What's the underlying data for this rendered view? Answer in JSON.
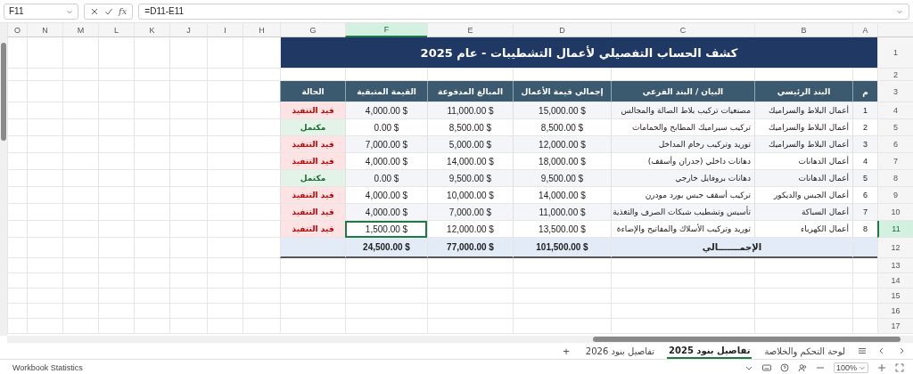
{
  "formula_bar": {
    "name_box": "F11",
    "function_label": "fx",
    "formula": "=D11-E11"
  },
  "column_headers": [
    {
      "label": "A",
      "selected": false
    },
    {
      "label": "B",
      "selected": false
    },
    {
      "label": "C",
      "selected": false
    },
    {
      "label": "D",
      "selected": false
    },
    {
      "label": "E",
      "selected": false
    },
    {
      "label": "F",
      "selected": true
    },
    {
      "label": "G",
      "selected": false
    },
    {
      "label": "H",
      "selected": false
    },
    {
      "label": "I",
      "selected": false
    },
    {
      "label": "J",
      "selected": false
    },
    {
      "label": "K",
      "selected": false
    },
    {
      "label": "L",
      "selected": false
    },
    {
      "label": "M",
      "selected": false
    },
    {
      "label": "N",
      "selected": false
    },
    {
      "label": "O",
      "selected": false
    }
  ],
  "title": "كشف الحساب التفصيلي لأعمال التشطيبات - عام 2025",
  "table": {
    "columns": [
      "م",
      "البند الرئيسي",
      "البيان / البند الفرعي",
      "إجمالي قيمة الأعمال",
      "المبالغ المدفوعة",
      "القيمة المتبقية",
      "الحالة"
    ],
    "rows": [
      {
        "row_number": "4",
        "index": "1",
        "main": "أعمال البلاط والسراميك",
        "sub": "مصنعيات تركيب بلاط الصالة والمجالس",
        "total": "15,000.00 $",
        "paid": "11,000.00 $",
        "remaining": "4,000.00 $",
        "remaining_selected": false,
        "status": {
          "text": "قيد التنفيذ",
          "kind": "pending"
        }
      },
      {
        "row_number": "5",
        "index": "2",
        "main": "أعمال البلاط والسراميك",
        "sub": "تركيب سيراميك المطابخ والحمامات",
        "total": "8,500.00 $",
        "paid": "8,500.00 $",
        "remaining": "0.00 $",
        "remaining_selected": false,
        "status": {
          "text": "مكتمل",
          "kind": "done"
        }
      },
      {
        "row_number": "6",
        "index": "3",
        "main": "أعمال البلاط والسراميك",
        "sub": "توريد وتركيب رخام المداخل",
        "total": "12,000.00 $",
        "paid": "5,000.00 $",
        "remaining": "7,000.00 $",
        "remaining_selected": false,
        "status": {
          "text": "قيد التنفيذ",
          "kind": "pending"
        }
      },
      {
        "row_number": "7",
        "index": "4",
        "main": "أعمال الدهانات",
        "sub": "دهانات داخلي (جدران وأسقف)",
        "total": "18,000.00 $",
        "paid": "14,000.00 $",
        "remaining": "4,000.00 $",
        "remaining_selected": false,
        "status": {
          "text": "قيد التنفيذ",
          "kind": "pending"
        }
      },
      {
        "row_number": "8",
        "index": "5",
        "main": "أعمال الدهانات",
        "sub": "دهانات بروفايل خارجي",
        "total": "9,500.00 $",
        "paid": "9,500.00 $",
        "remaining": "0.00 $",
        "remaining_selected": false,
        "status": {
          "text": "مكتمل",
          "kind": "done"
        }
      },
      {
        "row_number": "9",
        "index": "6",
        "main": "أعمال الجبس والديكور",
        "sub": "تركيب أسقف جبس بورد مودرن",
        "total": "14,000.00 $",
        "paid": "10,000.00 $",
        "remaining": "4,000.00 $",
        "remaining_selected": false,
        "status": {
          "text": "قيد التنفيذ",
          "kind": "pending"
        }
      },
      {
        "row_number": "10",
        "index": "7",
        "main": "أعمال السباكة",
        "sub": "تأسيس وتشطيب شبكات الصرف والتغذية",
        "total": "11,000.00 $",
        "paid": "7,000.00 $",
        "remaining": "4,000.00 $",
        "remaining_selected": false,
        "status": {
          "text": "قيد التنفيذ",
          "kind": "pending"
        }
      },
      {
        "row_number": "11",
        "index": "8",
        "main": "أعمال الكهرباء",
        "sub": "توريد وتركيب الأسلاك والمفاتيح والإضاءة",
        "total": "13,500.00 $",
        "paid": "12,000.00 $",
        "remaining": "1,500.00 $",
        "remaining_selected": true,
        "status": {
          "text": "قيد التنفيذ",
          "kind": "pending"
        }
      }
    ],
    "totals": {
      "label": "الإجمـــــــالي",
      "total": "101,500.00 $",
      "paid": "77,000.00 $",
      "remaining": "24,500.00 $"
    }
  },
  "row_headers": [
    {
      "label": "1",
      "selected": false
    },
    {
      "label": "2",
      "selected": false
    },
    {
      "label": "3",
      "selected": false
    },
    {
      "label": "12",
      "selected": false
    },
    {
      "label": "13",
      "selected": false
    },
    {
      "label": "14",
      "selected": false
    },
    {
      "label": "15",
      "selected": false
    },
    {
      "label": "16",
      "selected": false
    },
    {
      "label": "17",
      "selected": false
    }
  ],
  "sheet_tabs": [
    {
      "label": "لوحة التحكم والخلاصة",
      "selected": false
    },
    {
      "label": "تفاصيل بنود 2025",
      "selected": true
    },
    {
      "label": "تفاصيل بنود 2026",
      "selected": false
    }
  ],
  "add_sheet": "+",
  "status_bar": {
    "label": "Workbook Statistics",
    "zoom": "100%"
  }
}
